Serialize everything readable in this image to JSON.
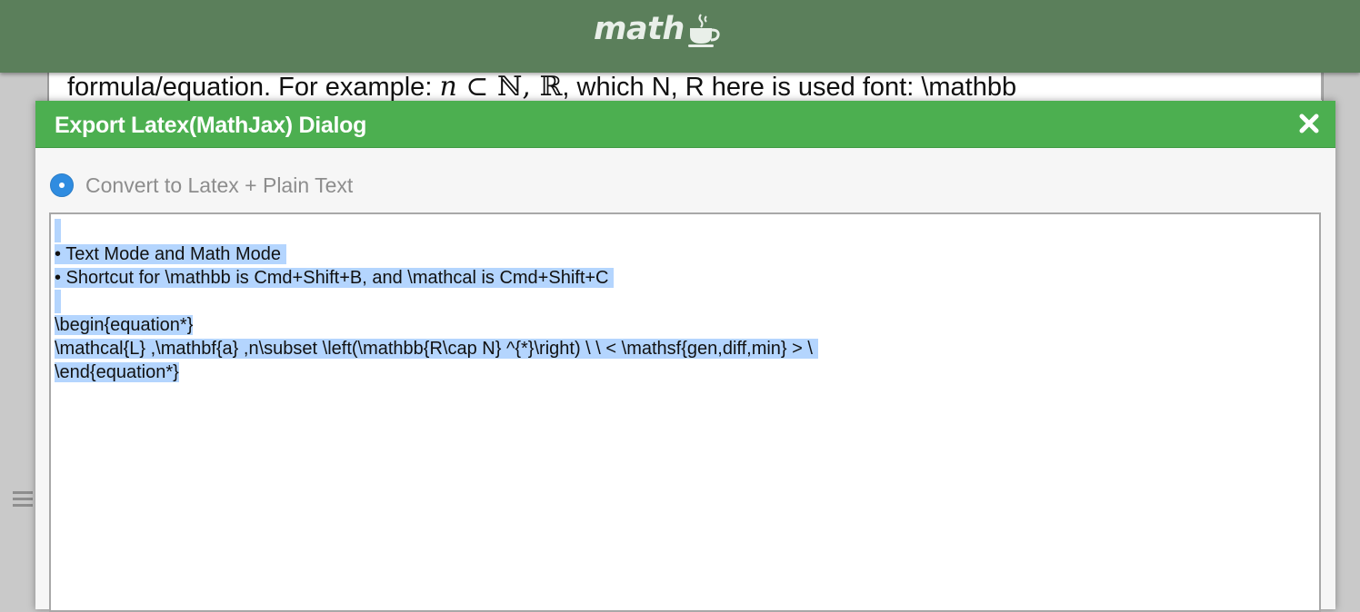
{
  "app": {
    "logo_text": "math"
  },
  "document": {
    "line_prefix": "formula/equation. For example: ",
    "math_n": "n",
    "math_subset": " ⊂ ",
    "math_N": "ℕ",
    "math_sep": ", ",
    "math_R": "ℝ",
    "line_suffix": ", which N, R here is used font: \\mathbb"
  },
  "dialog": {
    "title": "Export Latex(MathJax) Dialog",
    "close_icon": "close-icon",
    "option_label": "Convert to Latex + Plain Text",
    "option_selected": true,
    "output_lines": [
      "",
      "• Text Mode and Math Mode ",
      "• Shortcut for \\mathbb is Cmd+Shift+B, and \\mathcal is Cmd+Shift+C ",
      "",
      "\\begin{equation*}",
      "\\mathcal{L} ,\\mathbf{a} ,n\\subset \\left(\\mathbb{R\\cap N} ^{*}\\right) \\ \\ < \\mathsf{gen,diff,min} > \\ ",
      "\\end{equation*}"
    ]
  },
  "colors": {
    "header_bg": "#5b7f5b",
    "dialog_header_bg": "#4caf50",
    "radio": "#2f8ce0",
    "selection": "#b4d5fe"
  }
}
